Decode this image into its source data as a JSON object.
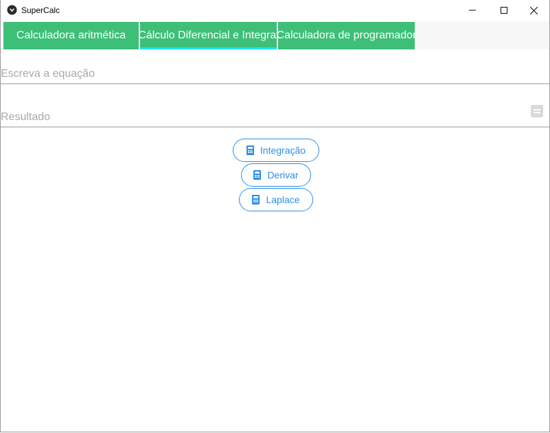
{
  "window": {
    "title": "SuperCalc"
  },
  "tabs": [
    {
      "label": "Calculadora aritmética",
      "selected": false
    },
    {
      "label": "Cálculo Diferencial e Integral",
      "selected": true
    },
    {
      "label": "Calculadora de programador",
      "selected": false
    }
  ],
  "equation_field": {
    "placeholder": "Escreva a equação",
    "value": ""
  },
  "result_field": {
    "placeholder": "Resultado",
    "value": "",
    "icon": "equals-icon"
  },
  "actions": [
    {
      "label": "Integração",
      "icon": "calculator-icon"
    },
    {
      "label": "Derivar",
      "icon": "calculator-icon"
    },
    {
      "label": "Laplace",
      "icon": "calculator-icon"
    }
  ],
  "colors": {
    "tab_background": "#3dbf78",
    "tab_indicator": "#1ee4f0",
    "button_accent": "#2a8ee6",
    "placeholder_text": "#a8a8a8"
  }
}
